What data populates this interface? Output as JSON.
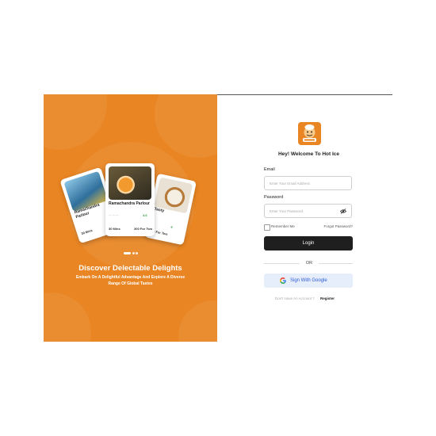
{
  "brand": {
    "accent": "#e98522",
    "dark_button": "#1f1f1f",
    "google_bg": "#e7eefb"
  },
  "hero": {
    "title": "Discover Delectable Delights",
    "subtitle": "Embark On A Delightful Advantage And Explore A Diverse Range Of Global Tastes",
    "carousel_pages": 3,
    "carousel_active": 1,
    "cards": [
      {
        "name": "Ramachandra Parlour",
        "time": "30 Mins",
        "price": "",
        "rating": ""
      },
      {
        "name": "Ramachandra Parlour",
        "time": "30 Mins",
        "price": "300 For Two",
        "rating": "4.6"
      },
      {
        "name": "Tasty",
        "time": "",
        "price": "300 For Two",
        "rating": "4"
      }
    ]
  },
  "login": {
    "logo_icon": "chef-logo-icon",
    "welcome": "Hey! Welcome To Hot Ice",
    "email_label": "Email",
    "email_placeholder": "Enter Your Email Address",
    "password_label": "Password",
    "password_placeholder": "Enter Your Password",
    "remember_me": "Remember Me",
    "forgot_password": "Forgot Password?",
    "login_button": "Login",
    "or": "OR",
    "google_button": "Sign With Google",
    "no_account": "Don't Have An Account ?",
    "register": "Register"
  }
}
